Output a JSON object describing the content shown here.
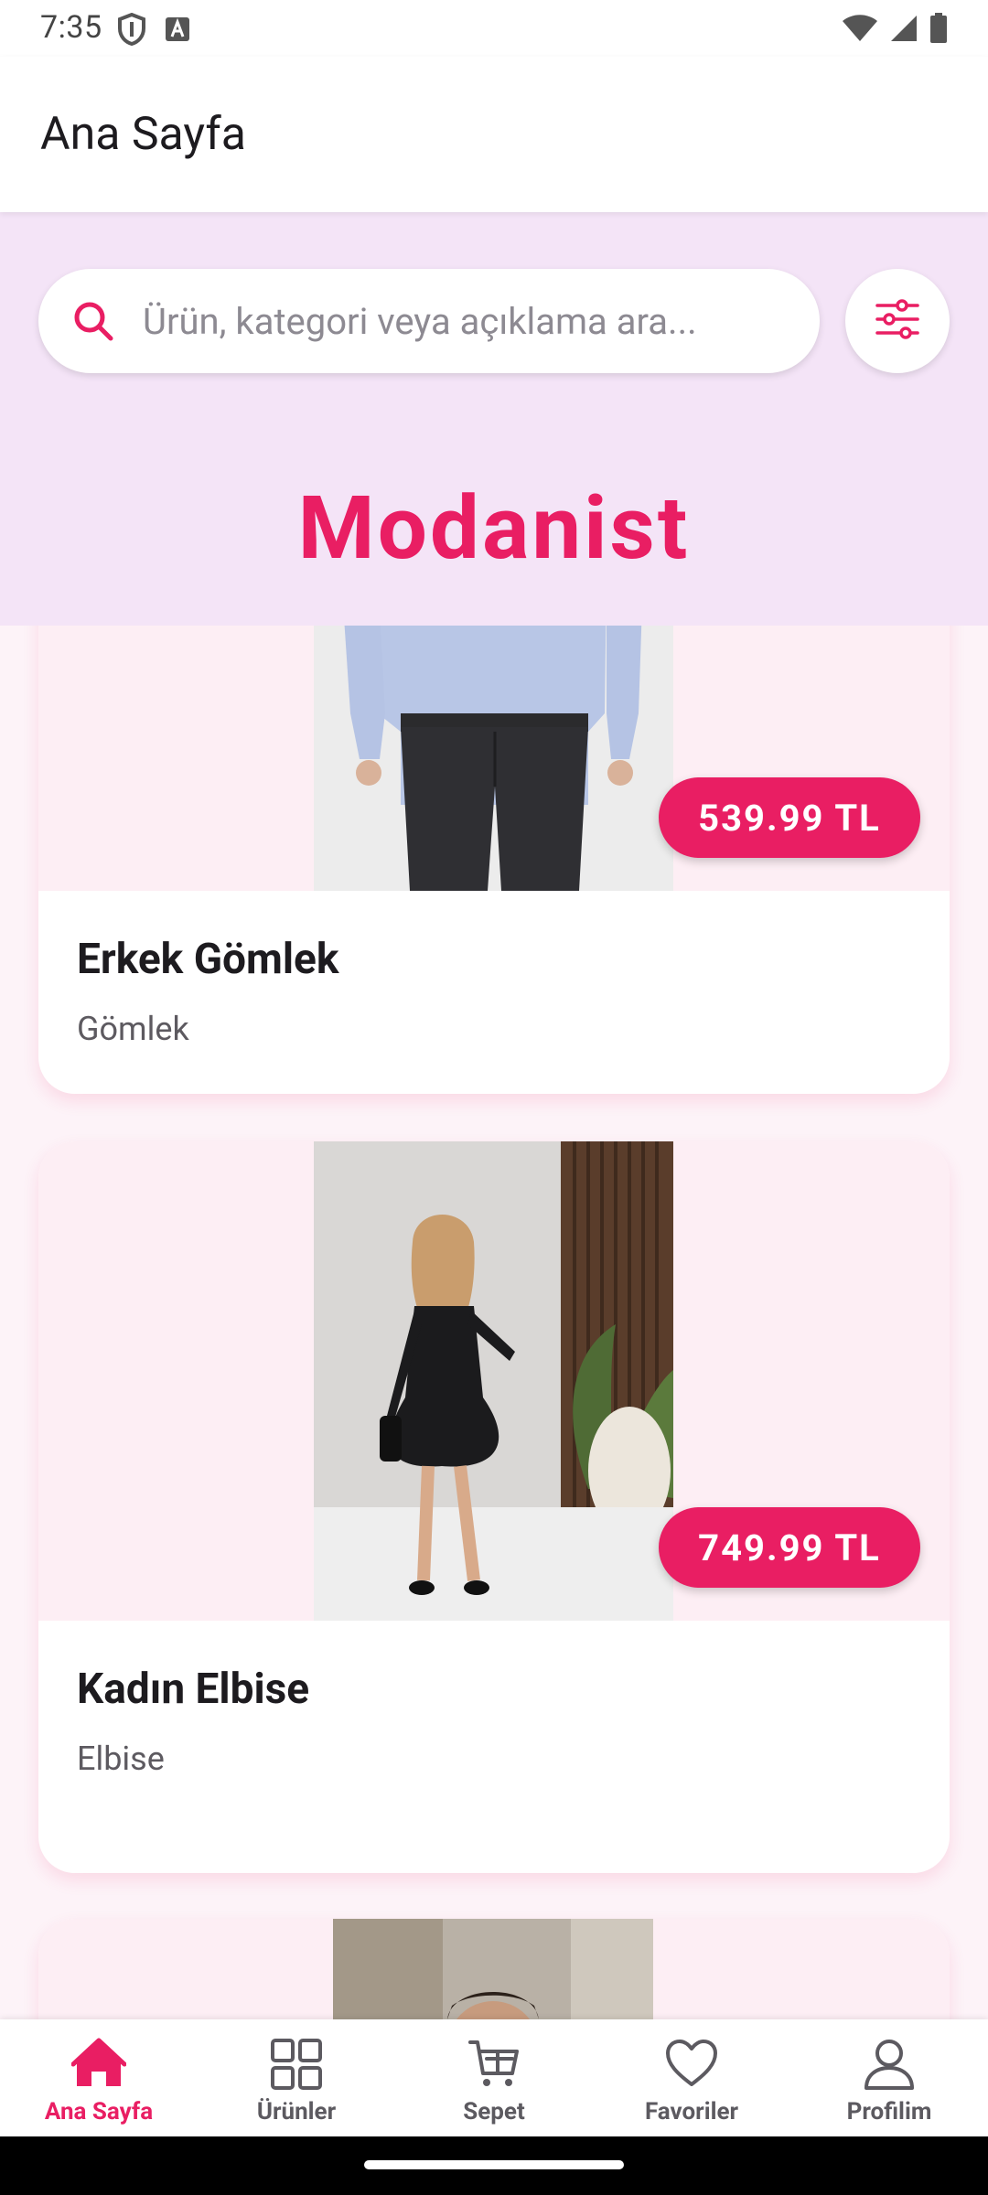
{
  "status_bar": {
    "time": "7:35",
    "icons": [
      "shield-icon",
      "font-icon",
      "wifi-icon",
      "signal-icon",
      "battery-icon"
    ]
  },
  "app_bar": {
    "title": "Ana Sayfa"
  },
  "search": {
    "placeholder": "Ürün, kategori veya açıklama ara..."
  },
  "brand": {
    "title": "Modanist"
  },
  "products": [
    {
      "name": "Erkek Gömlek",
      "category": "Gömlek",
      "price": "539.99 TL"
    },
    {
      "name": "Kadın Elbise",
      "category": "Elbise",
      "price": "749.99 TL"
    }
  ],
  "bottom_nav": {
    "items": [
      {
        "label": "Ana Sayfa",
        "icon": "home-icon",
        "active": true
      },
      {
        "label": "Ürünler",
        "icon": "grid-icon",
        "active": false
      },
      {
        "label": "Sepet",
        "icon": "cart-icon",
        "active": false
      },
      {
        "label": "Favoriler",
        "icon": "heart-icon",
        "active": false
      },
      {
        "label": "Profilim",
        "icon": "profile-icon",
        "active": false
      }
    ]
  },
  "colors": {
    "accent": "#e91e63",
    "header_background": "#f4e4f7",
    "card_image_background": "#fdeef4",
    "nav_inactive": "#5c5a60"
  }
}
